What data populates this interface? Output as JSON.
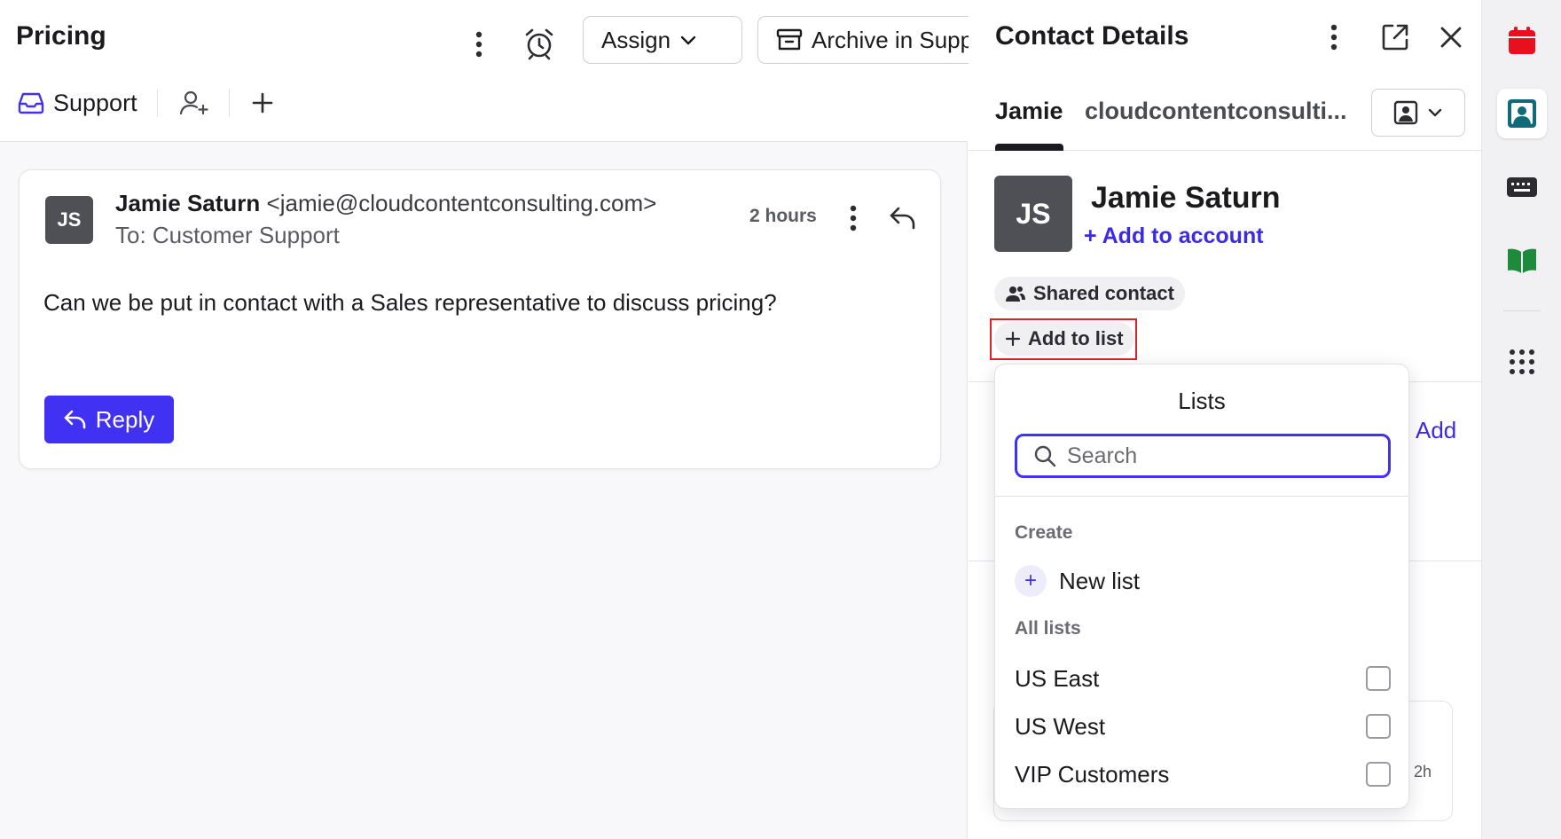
{
  "conversation": {
    "title": "Pricing",
    "assign_label": "Assign",
    "archive_label": "Archive in Support",
    "inbox_label": "Support"
  },
  "message": {
    "avatar_initials": "JS",
    "sender_name": "Jamie Saturn",
    "sender_email": "<jamie@cloudcontentconsulting.com>",
    "to_line": "To: Customer Support",
    "time": "2 hours",
    "body": "Can we be put in contact with a Sales representative to discuss pricing?",
    "reply_label": "Reply"
  },
  "contact_panel": {
    "title": "Contact Details",
    "tabs": [
      {
        "label": "Jamie",
        "active": true
      },
      {
        "label": "cloudcontentconsulti...",
        "active": false
      }
    ],
    "avatar_initials": "JS",
    "name": "Jamie Saturn",
    "add_to_account": "+ Add to account",
    "shared_contact": "Shared contact",
    "add_to_list": "Add to list",
    "add_link": "Add",
    "bg_time": "2h"
  },
  "lists_dropdown": {
    "title": "Lists",
    "search_placeholder": "Search",
    "create_section": "Create",
    "new_list": "New list",
    "all_lists_section": "All lists",
    "items": [
      {
        "label": "US East",
        "checked": false
      },
      {
        "label": "US West",
        "checked": false
      },
      {
        "label": "VIP Customers",
        "checked": false
      }
    ]
  },
  "rail": {
    "icons": [
      "calendar-icon",
      "contact-card-icon",
      "keyboard-icon",
      "book-icon",
      "apps-grid-icon"
    ]
  },
  "colors": {
    "accent": "#4131f2",
    "highlight_border": "#e0202a",
    "calendar_red": "#e8101e",
    "contact_teal": "#0f6b7a",
    "book_green": "#1e8a3c"
  }
}
